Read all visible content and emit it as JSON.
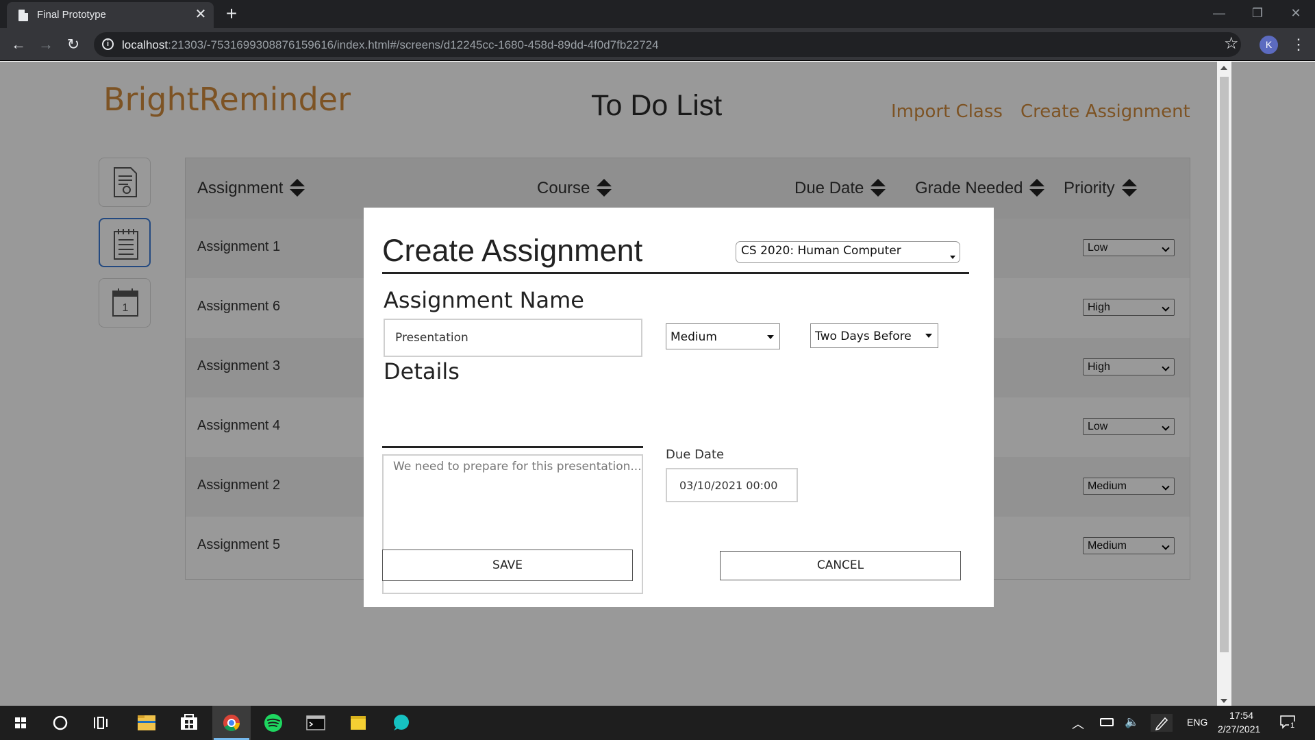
{
  "browser": {
    "tab_title": "Final Prototype",
    "tab_close": "✕",
    "new_tab": "+",
    "url_host": "localhost",
    "url_rest": ":21303/-7531699308876159616/index.html#/screens/d12245cc-1680-458d-89dd-4f0d7fb22724",
    "profile_initial": "K",
    "back": "←",
    "forward": "→",
    "reload": "↻",
    "star": "☆",
    "menu": "⋮",
    "minimize": "—",
    "restore": "❐",
    "close": "✕"
  },
  "app": {
    "brand": "BrightReminder",
    "page_title": "To Do List",
    "nav": {
      "import_class": "Import Class",
      "create_assignment": "Create Assignment"
    },
    "sidebar": [
      "certificate-icon",
      "notepad-icon",
      "calendar-icon"
    ],
    "calendar_day": "1",
    "table": {
      "headers": [
        "Assignment",
        "Course",
        "Due Date",
        "Grade Needed",
        "Priority"
      ],
      "rows": [
        {
          "name": "Assignment 1",
          "priority": "Low"
        },
        {
          "name": "Assignment 6",
          "priority": "High"
        },
        {
          "name": "Assignment 3",
          "priority": "High"
        },
        {
          "name": "Assignment 4",
          "priority": "Low"
        },
        {
          "name": "Assignment 2",
          "priority": "Medium"
        },
        {
          "name": "Assignment 5",
          "priority": "Medium"
        }
      ]
    }
  },
  "modal": {
    "title": "Create Assignment",
    "course": "CS 2020: Human Computer",
    "name_label": "Assignment Name",
    "name_value": "Presentation",
    "priority": "Medium",
    "reminder": "Two Days Before",
    "details_label": "Details",
    "details_placeholder": "We need to prepare for this presentation...",
    "due_label": "Due Date",
    "due_value": "03/10/2021 00:00",
    "save": "SAVE",
    "cancel": "CANCEL"
  },
  "taskbar": {
    "apps": [
      "windows-start-icon",
      "cortana-icon",
      "task-view-icon",
      "file-explorer-icon",
      "store-icon",
      "chrome-icon",
      "spotify-icon",
      "terminal-icon",
      "sticky-notes-icon",
      "app-icon"
    ],
    "language": "ENG",
    "time": "17:54",
    "date": "2/27/2021",
    "notifications": "1"
  },
  "colors": {
    "brand": "#d08b3c",
    "active_sidebar": "#3b7bd6",
    "chrome_dark": "#202124",
    "taskbar": "#1e1e1e"
  }
}
